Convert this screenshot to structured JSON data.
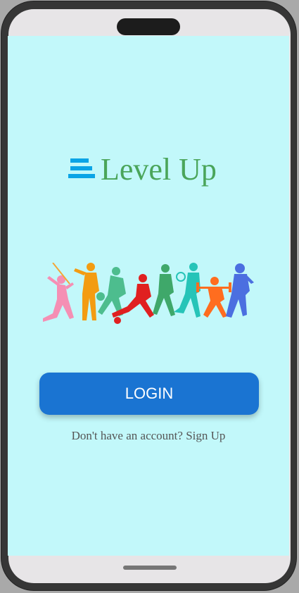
{
  "app": {
    "title": "Level Up",
    "logo_icon": "stacked-bars-icon",
    "brand_color": "#4aa55a",
    "icon_color": "#0aa4e6",
    "background_color": "#c2f8fa"
  },
  "banner": {
    "image": "sports-athletes-silhouettes",
    "colors": [
      "#f58fb4",
      "#f39c12",
      "#4dbd8e",
      "#e02020",
      "#3fa86a",
      "#26c4b8",
      "#ff6d1f",
      "#4b6fe0"
    ]
  },
  "login": {
    "label": "LOGIN",
    "color": "#1a74d2"
  },
  "signup": {
    "prompt": "Don't have an account?",
    "link_label": "Sign Up"
  }
}
